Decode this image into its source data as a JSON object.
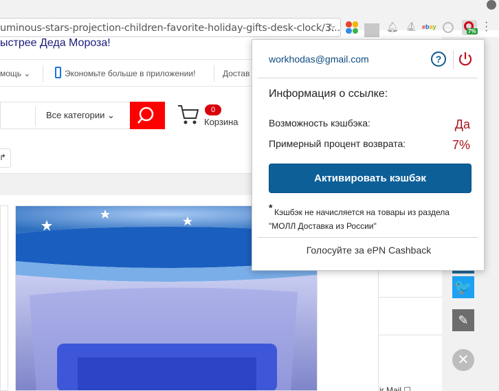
{
  "browser": {
    "url": "uminous-stars-projection-children-favorite-holiday-gifts-desk-clock/3...",
    "extensions": [
      "color-dots",
      "gray",
      "bell",
      "ship",
      "ebay",
      "circle",
      "epn-cashback"
    ],
    "ebay_label": {
      "e": "e",
      "b": "b",
      "a": "a",
      "y": "y"
    },
    "epn_badge": "7%"
  },
  "page": {
    "banner": "ыстрее Деда Мороза!",
    "nav": {
      "help": "мощь ⌄",
      "app": "Экономьте больше в приложении!",
      "delivery": "Достав"
    },
    "search": {
      "categories": "Все категории ⌄"
    },
    "cart": {
      "count": "0",
      "label": "Корзина"
    },
    "share_glyph": "↱",
    "air_mail": "ir Mail ☐"
  },
  "sidebar": {
    "twitter_glyph": "🐦",
    "pen_glyph": "✎",
    "close_glyph": "✕"
  },
  "popup": {
    "email": "workhodas@gmail.com",
    "help_glyph": "?",
    "heading": "Информация о ссылке:",
    "cashback_label": "Возможность кэшбэка:",
    "cashback_value": "Да",
    "rate_label": "Примерный процент возврата:",
    "rate_value": "7%",
    "activate_label": "Активировать кэшбэк",
    "note_star": "*",
    "note": "Кэшбэк не начисляется на товары из раздела \"МОЛЛ Доставка из России\"",
    "vote": "Голосуйте за ePN Cashback"
  },
  "colors": {
    "accent_blue": "#0d5f97",
    "value_red": "#a8141c",
    "search_red": "#ff0000",
    "epn_red": "#d0021b"
  }
}
